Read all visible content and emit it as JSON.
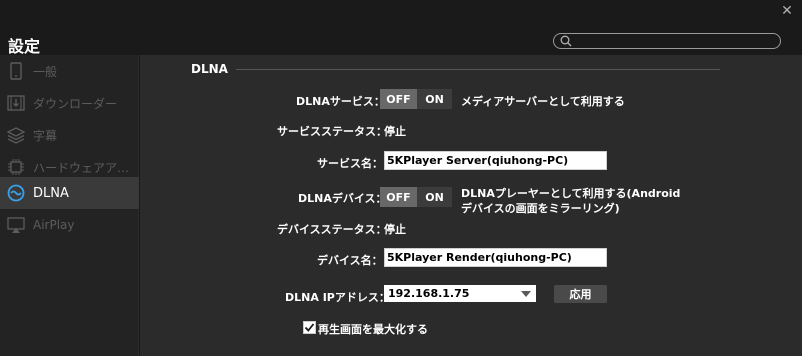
{
  "window": {
    "close_label": "✕"
  },
  "header": {
    "title": "設定",
    "search_placeholder": ""
  },
  "sidebar": {
    "items": [
      {
        "label": "一般",
        "icon": "phone-icon"
      },
      {
        "label": "ダウンローダー",
        "icon": "film-download-icon"
      },
      {
        "label": "字幕",
        "icon": "layers-icon"
      },
      {
        "label": "ハードウェアア…",
        "icon": "chip-icon"
      },
      {
        "label": "DLNA",
        "icon": "dlna-icon",
        "active": true
      },
      {
        "label": "AirPlay",
        "icon": "airplay-icon"
      }
    ]
  },
  "dlna": {
    "section_title": "DLNA",
    "service_label": "DLNAサービス：",
    "service_toggle": {
      "off": "OFF",
      "on": "ON",
      "state": "OFF"
    },
    "service_description": "メディアサーバーとして利用する",
    "service_status_label": "サービスステータス：",
    "service_status_value": "停止",
    "service_name_label": "サービス名：",
    "service_name_value": "5KPlayer Server(qiuhong-PC)",
    "device_label": "DLNAデバイス：",
    "device_toggle": {
      "off": "OFF",
      "on": "ON",
      "state": "OFF"
    },
    "device_description_line1": "DLNAプレーヤーとして利用する(Android",
    "device_description_line2": "デバイスの画面をミラーリング)",
    "device_status_label": "デバイスステータス：",
    "device_status_value": "停止",
    "device_name_label": "デバイス名：",
    "device_name_value": "5KPlayer Render(qiuhong-PC)",
    "ip_label": "DLNA IPアドレス：",
    "ip_value": "192.168.1.75",
    "apply_label": "応用",
    "maximize_label": "再生画面を最大化する",
    "maximize_checked": true
  }
}
